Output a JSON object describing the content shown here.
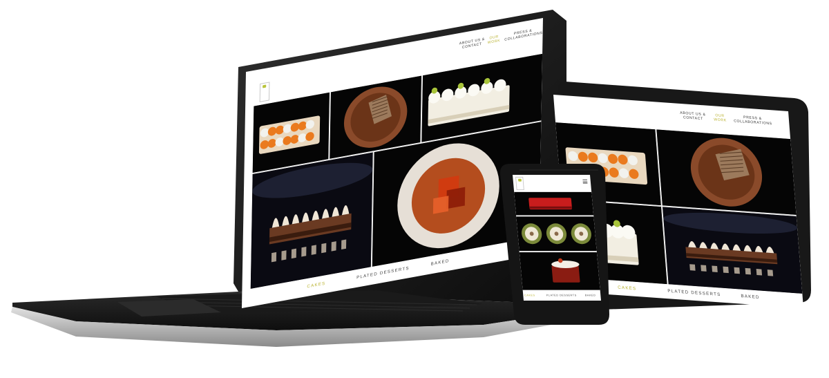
{
  "site": {
    "nav": [
      {
        "label_line1": "ABOUT US &",
        "label_line2": "CONTACT",
        "active": false
      },
      {
        "label_line1": "OUR",
        "label_line2": "WORK",
        "active": true
      },
      {
        "label_line1": "PRESS &",
        "label_line2": "COLLABORATIONS",
        "active": false
      }
    ],
    "tabs": [
      {
        "label": "CAKES",
        "active": true
      },
      {
        "label": "PLATED DESSERTS",
        "active": false
      },
      {
        "label": "BAKED",
        "active": false
      }
    ],
    "menu_icon": "hamburger-icon",
    "logo_icon": "leaf-logo-icon"
  },
  "gallery": [
    {
      "name": "orange-spheres-cake",
      "kind": "orange-cake"
    },
    {
      "name": "chocolate-tart-plate",
      "kind": "choc-plate"
    },
    {
      "name": "white-entremet",
      "kind": "white-cake"
    },
    {
      "name": "meringue-chocolate-bar",
      "kind": "meringue-bar"
    },
    {
      "name": "red-jelly-plate",
      "kind": "red-plate"
    }
  ],
  "colors": {
    "accent": "#b9b22f",
    "photo_background": "#000000",
    "device_frame": "#1c1c1c"
  }
}
